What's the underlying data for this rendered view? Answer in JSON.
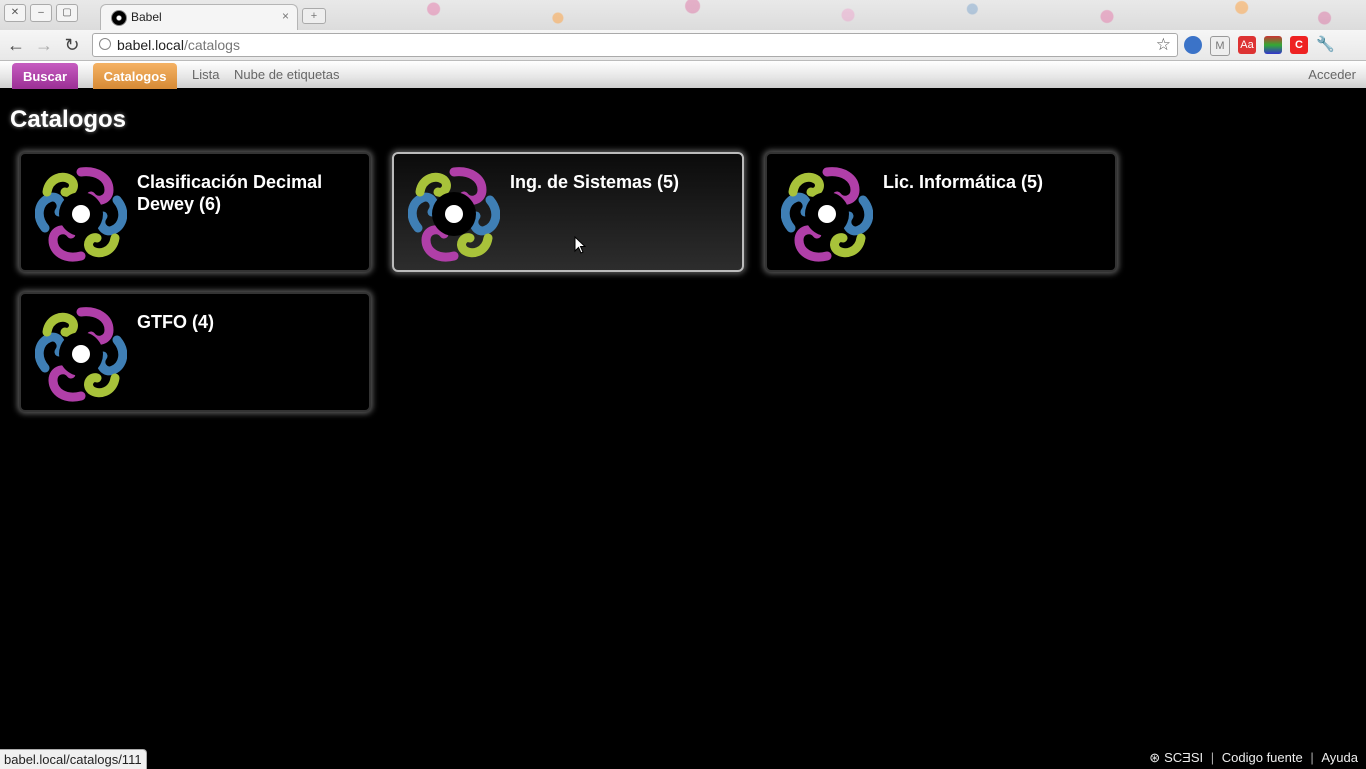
{
  "browser": {
    "tab_title": "Babel",
    "url_host": "babel.local",
    "url_path": "/catalogs",
    "new_tab_symbol": "+",
    "close_symbol": "×"
  },
  "appnav": {
    "buscar_label": "Buscar",
    "catalogos_label": "Catalogos",
    "lista_label": "Lista",
    "nube_label": "Nube de etiquetas",
    "acceder_label": "Acceder"
  },
  "page": {
    "title": "Catalogos",
    "catalogs": [
      {
        "name": "Clasificación Decimal Dewey (6)"
      },
      {
        "name": "Ing. de Sistemas (5)"
      },
      {
        "name": "Lic. Informática (5)"
      },
      {
        "name": "GTFO (4)"
      }
    ]
  },
  "status": {
    "hover_url": "babel.local/catalogs/111"
  },
  "footer": {
    "brand": "SCƎSI",
    "codigo_label": "Codigo fuente",
    "ayuda_label": "Ayuda"
  },
  "colors": {
    "buscar": "#9b2f95",
    "catalogos": "#d68a35",
    "logo_purple": "#b03fa8",
    "logo_green": "#a8c23a",
    "logo_blue": "#3f7fb5"
  }
}
